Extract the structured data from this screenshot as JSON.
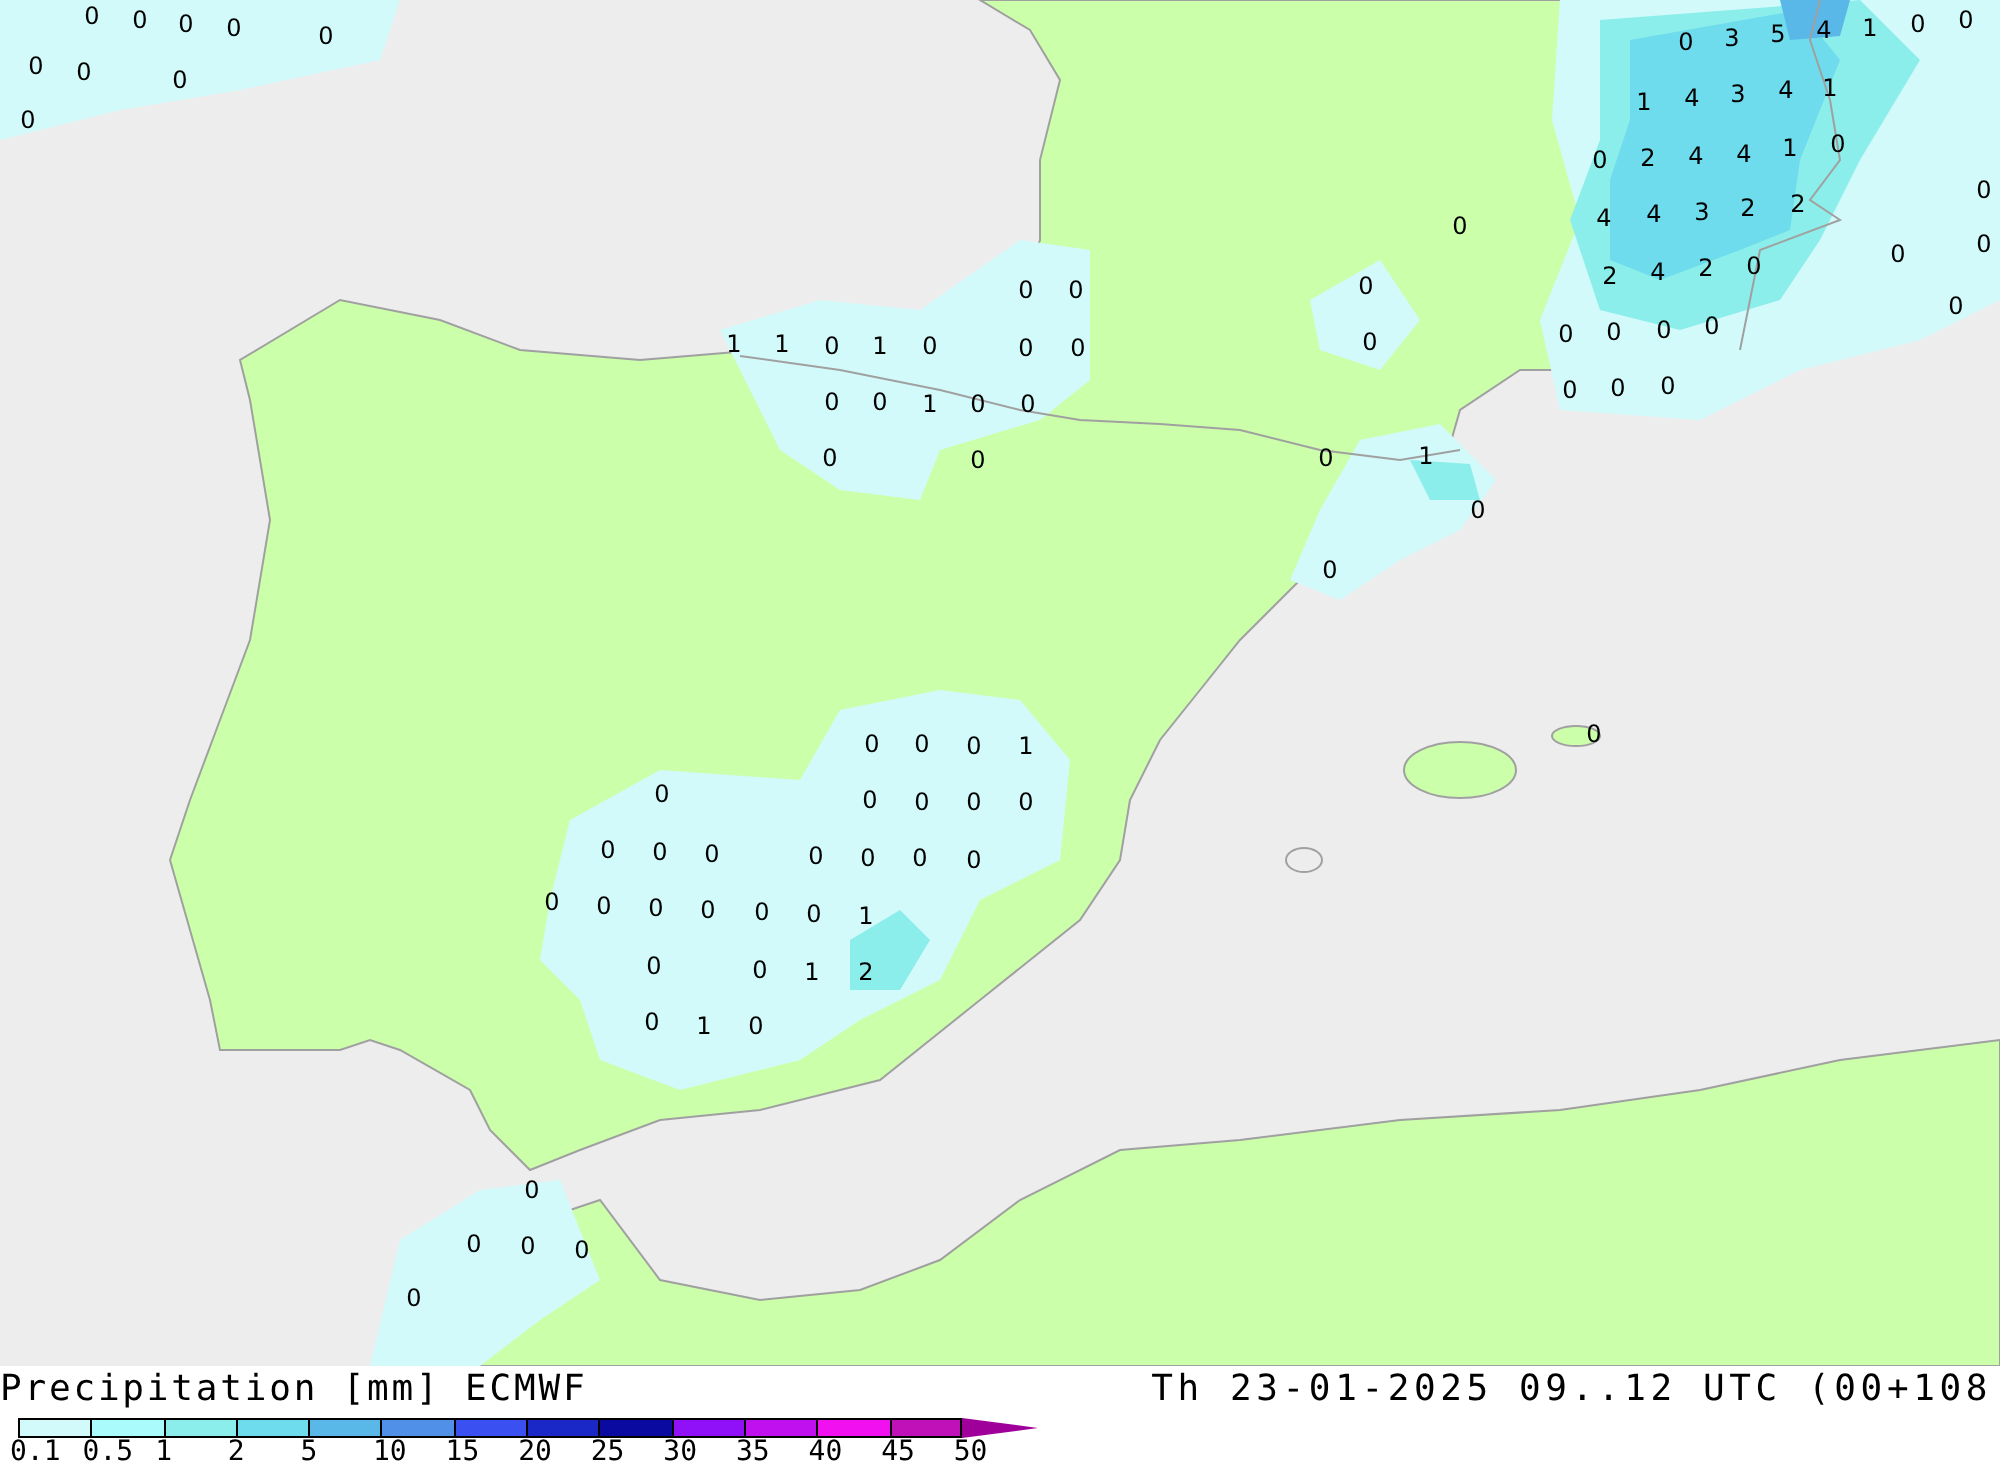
{
  "map": {
    "labels": [
      "0",
      "0",
      "0",
      "0",
      "0",
      "0",
      "3",
      "5",
      "4",
      "1",
      "0",
      "0",
      "0",
      "0",
      "0",
      "1",
      "4",
      "3",
      "4",
      "1",
      "0",
      "0",
      "2",
      "4",
      "4",
      "1",
      "0",
      "0",
      "0",
      "4",
      "4",
      "3",
      "2",
      "2",
      "0",
      "0",
      "0",
      "2",
      "4",
      "2",
      "0",
      "0",
      "0",
      "1",
      "1",
      "0",
      "1",
      "0",
      "0",
      "0",
      "0",
      "0",
      "0",
      "0",
      "0",
      "0",
      "0",
      "0",
      "1",
      "0",
      "0",
      "0",
      "0",
      "0",
      "0",
      "0",
      "0",
      "1",
      "0",
      "0",
      "0",
      "0",
      "0",
      "1",
      "0",
      "0",
      "0",
      "0",
      "0",
      "0",
      "0",
      "0",
      "0",
      "0",
      "0",
      "0",
      "0",
      "0",
      "0",
      "0",
      "0",
      "0",
      "0",
      "1",
      "0",
      "0",
      "1",
      "2",
      "0",
      "1",
      "0",
      "0",
      "0",
      "0",
      "0",
      "0"
    ]
  },
  "legend": {
    "title": "Precipitation [mm] ECMWF",
    "bins": [
      {
        "label": "0.1",
        "color": "#d2fafa"
      },
      {
        "label": "0.5",
        "color": "#aafcfc"
      },
      {
        "label": "1",
        "color": "#8ceeea"
      },
      {
        "label": "2",
        "color": "#6edcec"
      },
      {
        "label": "5",
        "color": "#5ab8e8"
      },
      {
        "label": "10",
        "color": "#5090e8"
      },
      {
        "label": "15",
        "color": "#3a50f0"
      },
      {
        "label": "20",
        "color": "#1a28c8"
      },
      {
        "label": "25",
        "color": "#0a0aa0"
      },
      {
        "label": "30",
        "color": "#9010f8"
      },
      {
        "label": "35",
        "color": "#c010f0"
      },
      {
        "label": "40",
        "color": "#f010f0"
      },
      {
        "label": "45",
        "color": "#c010b8"
      }
    ],
    "end_label": "50"
  },
  "valid_time": "Th 23-01-2025 09..12 UTC (00+108"
}
